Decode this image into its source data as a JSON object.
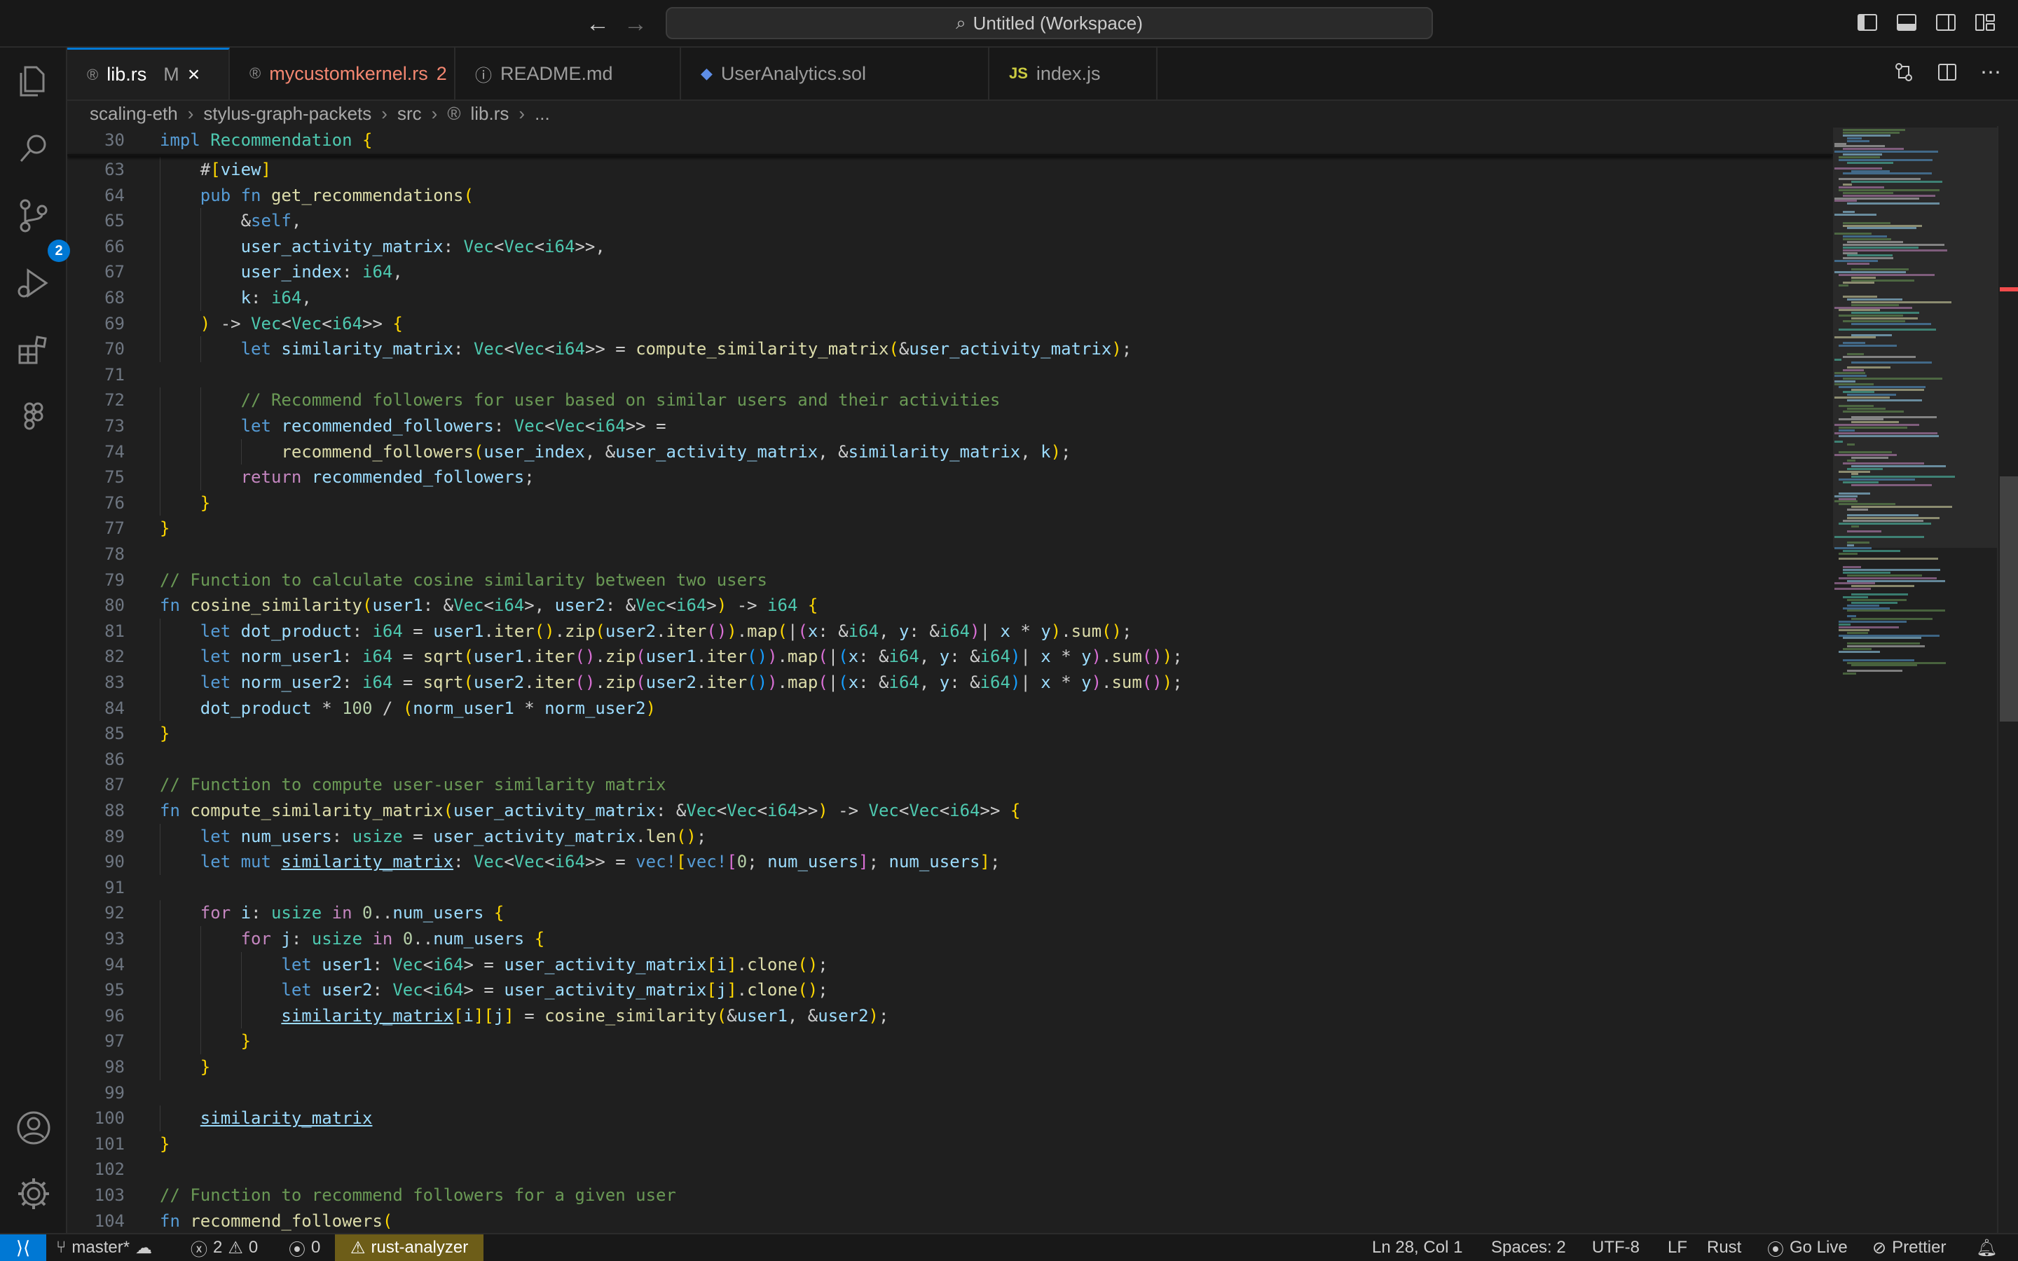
{
  "titlebar": {
    "title": "Untitled (Workspace)",
    "back": "←",
    "forward": "→"
  },
  "activity": {
    "scm_badge": "2"
  },
  "tabs": [
    {
      "label": "lib.rs",
      "badge": "M",
      "active": true
    },
    {
      "label": "mycustomkernel.rs",
      "badge": "2"
    },
    {
      "label": "README.md"
    },
    {
      "label": "UserAnalytics.sol"
    },
    {
      "label": "index.js",
      "icon_text": "JS"
    }
  ],
  "breadcrumb": [
    "scaling-eth",
    "stylus-graph-packets",
    "src",
    "lib.rs",
    "..."
  ],
  "editor": {
    "sticky_line": {
      "n": "30",
      "text": "impl Recommendation {"
    },
    "lines": [
      {
        "n": "63",
        "text": "    #[view]"
      },
      {
        "n": "64",
        "text": "    pub fn get_recommendations("
      },
      {
        "n": "65",
        "text": "        &self,"
      },
      {
        "n": "66",
        "text": "        user_activity_matrix: Vec<Vec<i64>>,"
      },
      {
        "n": "67",
        "text": "        user_index: i64,"
      },
      {
        "n": "68",
        "text": "        k: i64,"
      },
      {
        "n": "69",
        "text": "    ) -> Vec<Vec<i64>> {"
      },
      {
        "n": "70",
        "text": "        let similarity_matrix: Vec<Vec<i64>> = compute_similarity_matrix(&user_activity_matrix);"
      },
      {
        "n": "71",
        "text": ""
      },
      {
        "n": "72",
        "text": "        // Recommend followers for user based on similar users and their activities"
      },
      {
        "n": "73",
        "text": "        let recommended_followers: Vec<Vec<i64>> ="
      },
      {
        "n": "74",
        "text": "            recommend_followers(user_index, &user_activity_matrix, &similarity_matrix, k);"
      },
      {
        "n": "75",
        "text": "        return recommended_followers;"
      },
      {
        "n": "76",
        "text": "    }"
      },
      {
        "n": "77",
        "text": "}"
      },
      {
        "n": "78",
        "text": ""
      },
      {
        "n": "79",
        "text": "// Function to calculate cosine similarity between two users"
      },
      {
        "n": "80",
        "text": "fn cosine_similarity(user1: &Vec<i64>, user2: &Vec<i64>) -> i64 {"
      },
      {
        "n": "81",
        "text": "    let dot_product: i64 = user1.iter().zip(user2.iter()).map(|(x: &i64, y: &i64)| x * y).sum();"
      },
      {
        "n": "82",
        "text": "    let norm_user1: i64 = sqrt(user1.iter().zip(user1.iter()).map(|(x: &i64, y: &i64)| x * y).sum());"
      },
      {
        "n": "83",
        "text": "    let norm_user2: i64 = sqrt(user2.iter().zip(user2.iter()).map(|(x: &i64, y: &i64)| x * y).sum());"
      },
      {
        "n": "84",
        "text": "    dot_product * 100 / (norm_user1 * norm_user2)"
      },
      {
        "n": "85",
        "text": "}"
      },
      {
        "n": "86",
        "text": ""
      },
      {
        "n": "87",
        "text": "// Function to compute user-user similarity matrix"
      },
      {
        "n": "88",
        "text": "fn compute_similarity_matrix(user_activity_matrix: &Vec<Vec<i64>>) -> Vec<Vec<i64>> {"
      },
      {
        "n": "89",
        "text": "    let num_users: usize = user_activity_matrix.len();"
      },
      {
        "n": "90",
        "text": "    let mut similarity_matrix: Vec<Vec<i64>> = vec![vec![0; num_users]; num_users];"
      },
      {
        "n": "91",
        "text": ""
      },
      {
        "n": "92",
        "text": "    for i: usize in 0..num_users {"
      },
      {
        "n": "93",
        "text": "        for j: usize in 0..num_users {"
      },
      {
        "n": "94",
        "text": "            let user1: Vec<i64> = user_activity_matrix[i].clone();"
      },
      {
        "n": "95",
        "text": "            let user2: Vec<i64> = user_activity_matrix[j].clone();"
      },
      {
        "n": "96",
        "text": "            similarity_matrix[i][j] = cosine_similarity(&user1, &user2);"
      },
      {
        "n": "97",
        "text": "        }"
      },
      {
        "n": "98",
        "text": "    }"
      },
      {
        "n": "99",
        "text": ""
      },
      {
        "n": "100",
        "text": "    similarity_matrix"
      },
      {
        "n": "101",
        "text": "}"
      },
      {
        "n": "102",
        "text": ""
      },
      {
        "n": "103",
        "text": "// Function to recommend followers for a given user"
      },
      {
        "n": "104",
        "text": "fn recommend_followers("
      }
    ]
  },
  "statusbar": {
    "branch": "master*",
    "errors": "2",
    "warnings": "0",
    "ports": "0",
    "rust_analyzer": "rust-analyzer",
    "cursor": "Ln 28, Col 1",
    "spaces": "Spaces: 2",
    "encoding": "UTF-8",
    "eol": "LF",
    "language": "Rust",
    "go_live": "Go Live",
    "prettier": "Prettier"
  },
  "colors": {
    "accent": "#0078d4",
    "editor_bg": "#1f1f1f",
    "chrome_bg": "#181818",
    "error": "#f48771"
  }
}
